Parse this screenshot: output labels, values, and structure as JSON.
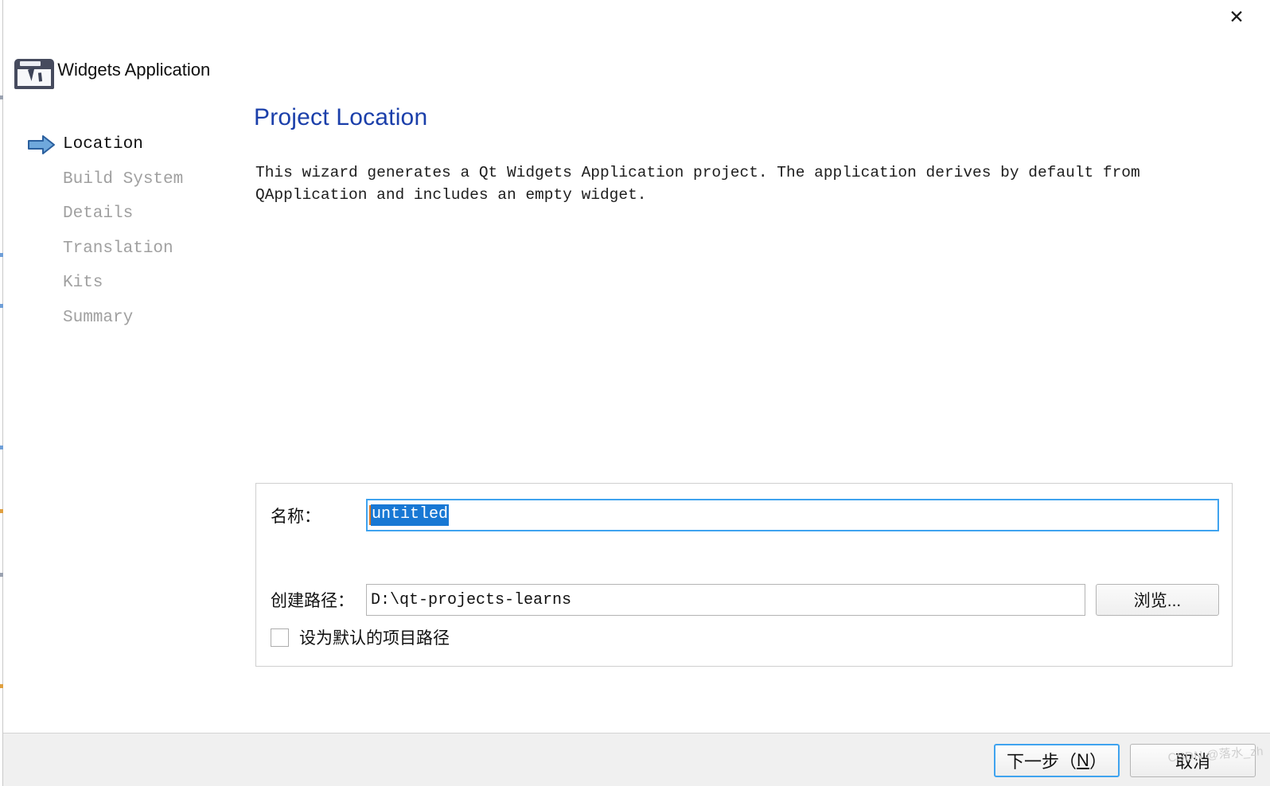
{
  "window": {
    "title": "Qt Widgets Application",
    "title_visible": "t Widgets Application",
    "close_label": "✕",
    "app_icon": "qt-widgets-app-icon"
  },
  "sidebar": {
    "items": [
      {
        "label": "Location",
        "active": true,
        "icon": "blue-arrow-icon"
      },
      {
        "label": "Build System",
        "active": false
      },
      {
        "label": "Details",
        "active": false
      },
      {
        "label": "Translation",
        "active": false
      },
      {
        "label": "Kits",
        "active": false
      },
      {
        "label": "Summary",
        "active": false
      }
    ]
  },
  "main": {
    "heading": "Project Location",
    "description": "This wizard generates a Qt Widgets Application project. The application derives by default from QApplication and includes an empty widget."
  },
  "form": {
    "name": {
      "label": "名称：",
      "value": "untitled",
      "selected": true
    },
    "path": {
      "label": "创建路径：",
      "value": "D:\\qt-projects-learns",
      "browse_label": "浏览..."
    },
    "default_path_checkbox": {
      "label": "设为默认的项目路径",
      "checked": false
    }
  },
  "footer": {
    "next_label_prefix": "下一步（",
    "next_mnemonic": "N",
    "next_label_suffix": "）",
    "cancel_label": "取消"
  },
  "watermark": {
    "text": "CSDN @落水_zh"
  },
  "colors": {
    "heading": "#1b3faa",
    "focus_border": "#3fa3ef",
    "selection_bg": "#1878d4",
    "footer_bg": "#f0f0f0",
    "inactive_nav": "#a0a0a0"
  }
}
